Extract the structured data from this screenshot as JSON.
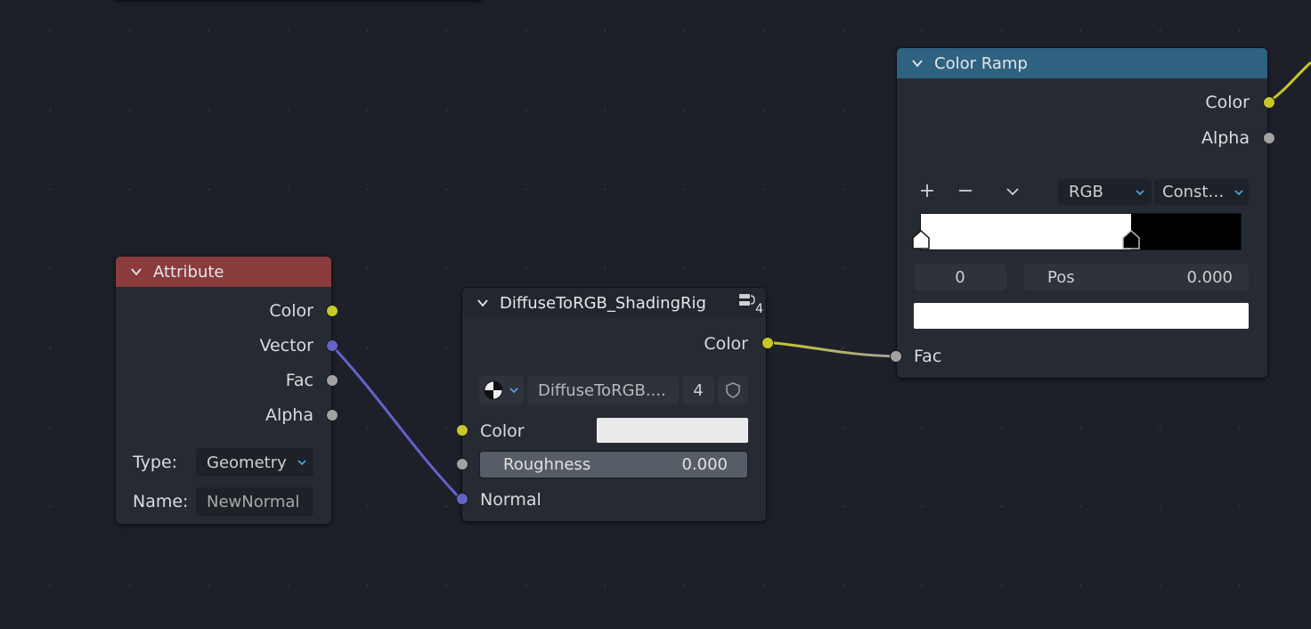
{
  "colors": {
    "attribute_header": "#8a3b3b",
    "group_header": "#23262e",
    "ramp_header": "#2f6280",
    "socket_color": "#c7c729",
    "socket_vector": "#6363c7",
    "socket_float": "#a1a1a1",
    "accent": "#4aa3df"
  },
  "attribute_node": {
    "title": "Attribute",
    "outputs": [
      "Color",
      "Vector",
      "Fac",
      "Alpha"
    ],
    "type_label": "Type:",
    "type_value": "Geometry",
    "name_label": "Name:",
    "name_value": "NewNormal"
  },
  "group_node": {
    "title": "DiffuseToRGB_ShadingRig",
    "user_count": "4",
    "output_color": "Color",
    "datablock_name": "DiffuseToRGB....",
    "datablock_users": "4",
    "inputs": {
      "color": "Color",
      "roughness_label": "Roughness",
      "roughness_value": "0.000",
      "normal": "Normal"
    }
  },
  "ramp_node": {
    "title": "Color Ramp",
    "outputs": [
      "Color",
      "Alpha"
    ],
    "color_mode": "RGB",
    "interpolation": "Const…",
    "stop_index": "0",
    "pos_label": "Pos",
    "pos_value": "0.000",
    "input_fac": "Fac",
    "stops": [
      {
        "position": 0.0,
        "color": "#ffffff"
      },
      {
        "position": 0.66,
        "color": "#000000"
      }
    ]
  }
}
